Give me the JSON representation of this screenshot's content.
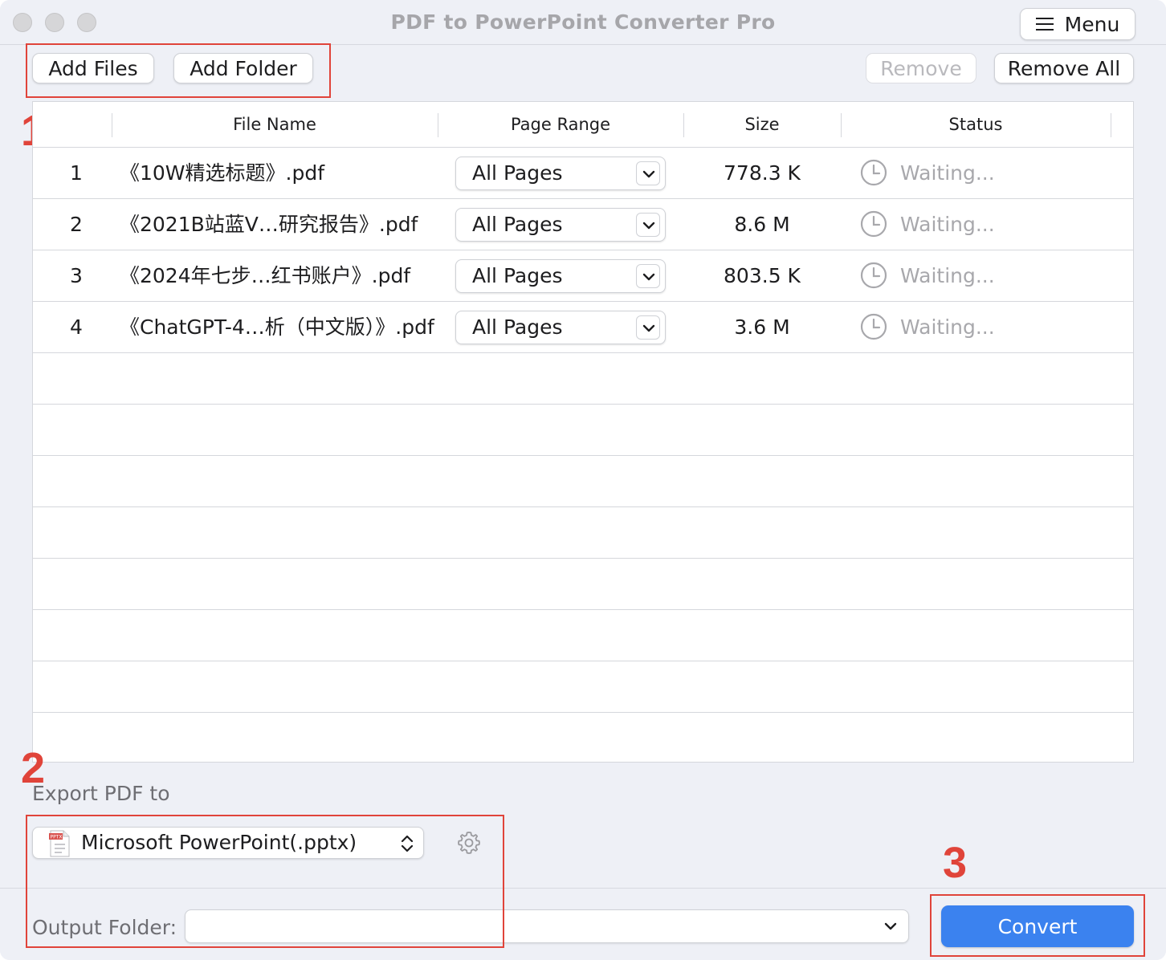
{
  "window": {
    "title": "PDF to PowerPoint Converter Pro"
  },
  "toolbar": {
    "menu_label": "Menu",
    "add_files_label": "Add Files",
    "add_folder_label": "Add Folder",
    "remove_label": "Remove",
    "remove_all_label": "Remove All"
  },
  "annotations": {
    "one": "1",
    "two": "2",
    "three": "3",
    "color": "#e0443a"
  },
  "table": {
    "columns": [
      "",
      "File Name",
      "Page Range",
      "Size",
      "Status"
    ],
    "rows": [
      {
        "index": "1",
        "file_name": "《10W精选标题》.pdf",
        "page_range": "All Pages",
        "size": "778.3 K",
        "status": "Waiting..."
      },
      {
        "index": "2",
        "file_name": "《2021B站蓝V…研究报告》.pdf",
        "page_range": "All Pages",
        "size": "8.6 M",
        "status": "Waiting..."
      },
      {
        "index": "3",
        "file_name": "《2024年七步…红书账户》.pdf",
        "page_range": "All Pages",
        "size": "803.5 K",
        "status": "Waiting..."
      },
      {
        "index": "4",
        "file_name": "《ChatGPT-4…析（中文版）》.pdf",
        "page_range": "All Pages",
        "size": "3.6 M",
        "status": "Waiting..."
      }
    ]
  },
  "export": {
    "label": "Export PDF to",
    "format_value": "Microsoft PowerPoint(.pptx)",
    "file_icon_text": "PPTX"
  },
  "output": {
    "label": "Output Folder:",
    "value": ""
  },
  "convert_label": "Convert",
  "colors": {
    "accent": "#3b82ef",
    "annotation": "#e0443a",
    "status_gray": "#a8a8ac"
  }
}
